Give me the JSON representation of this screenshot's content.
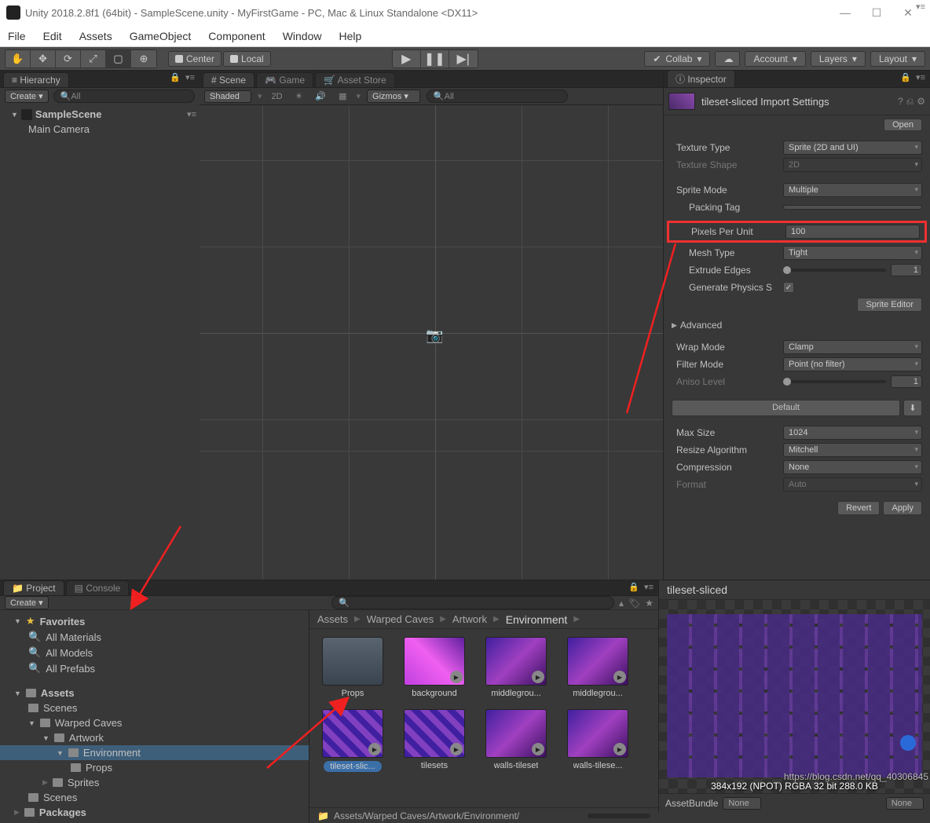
{
  "titlebar": {
    "title": "Unity 2018.2.8f1 (64bit) - SampleScene.unity - MyFirstGame - PC, Mac & Linux Standalone <DX11>"
  },
  "menubar": [
    "File",
    "Edit",
    "Assets",
    "GameObject",
    "Component",
    "Window",
    "Help"
  ],
  "toolbar": {
    "center": "Center",
    "local": "Local",
    "collab": "Collab",
    "account": "Account",
    "layers": "Layers",
    "layout": "Layout"
  },
  "hierarchy": {
    "tab": "Hierarchy",
    "create": "Create",
    "search": "All",
    "scene": "SampleScene",
    "items": [
      "Main Camera"
    ]
  },
  "scene": {
    "tabs": [
      "Scene",
      "Game",
      "Asset Store"
    ],
    "shading": "Shaded",
    "mode2d": "2D",
    "gizmos": "Gizmos",
    "search": "All"
  },
  "inspector": {
    "tab": "Inspector",
    "title": "tileset-sliced Import Settings",
    "open": "Open",
    "texture_type_label": "Texture Type",
    "texture_type": "Sprite (2D and UI)",
    "texture_shape_label": "Texture Shape",
    "texture_shape": "2D",
    "sprite_mode_label": "Sprite Mode",
    "sprite_mode": "Multiple",
    "packing_tag_label": "Packing Tag",
    "ppu_label": "Pixels Per Unit",
    "ppu": "100",
    "mesh_type_label": "Mesh Type",
    "mesh_type": "Tight",
    "extrude_label": "Extrude Edges",
    "extrude": "1",
    "gen_physics_label": "Generate Physics S",
    "sprite_editor": "Sprite Editor",
    "advanced": "Advanced",
    "wrap_label": "Wrap Mode",
    "wrap": "Clamp",
    "filter_label": "Filter Mode",
    "filter": "Point (no filter)",
    "aniso_label": "Aniso Level",
    "aniso": "1",
    "default": "Default",
    "max_size_label": "Max Size",
    "max_size": "1024",
    "resize_label": "Resize Algorithm",
    "resize": "Mitchell",
    "compression_label": "Compression",
    "compression": "None",
    "format_label": "Format",
    "format": "Auto",
    "revert": "Revert",
    "apply": "Apply"
  },
  "project": {
    "tabs": {
      "project": "Project",
      "console": "Console"
    },
    "create": "Create",
    "tree": {
      "favorites": "Favorites",
      "fav_items": [
        "All Materials",
        "All Models",
        "All Prefabs"
      ],
      "assets": "Assets",
      "scenes": "Scenes",
      "warped": "Warped Caves",
      "artwork": "Artwork",
      "environment": "Environment",
      "props": "Props",
      "sprites": "Sprites",
      "scenes2": "Scenes",
      "packages": "Packages"
    },
    "breadcrumb": [
      "Assets",
      "Warped Caves",
      "Artwork",
      "Environment"
    ],
    "items": [
      {
        "label": "Props",
        "type": "folder"
      },
      {
        "label": "background",
        "type": "purple"
      },
      {
        "label": "middlegrou...",
        "type": "purple2"
      },
      {
        "label": "middlegrou...",
        "type": "purple2"
      },
      {
        "label": "tileset-slic...",
        "type": "purple3",
        "selected": true
      },
      {
        "label": "tilesets",
        "type": "purple3"
      },
      {
        "label": "walls-tileset",
        "type": "purple2"
      },
      {
        "label": "walls-tilese...",
        "type": "purple2"
      }
    ],
    "footer": "Assets/Warped Caves/Artwork/Environment/"
  },
  "preview": {
    "title": "tileset-sliced",
    "meta": "384x192 (NPOT)  RGBA 32 bit   288.0 KB",
    "assetbundle": "AssetBundle",
    "none": "None",
    "none2": "None"
  },
  "watermark": "https://blog.csdn.net/qq_40306845"
}
